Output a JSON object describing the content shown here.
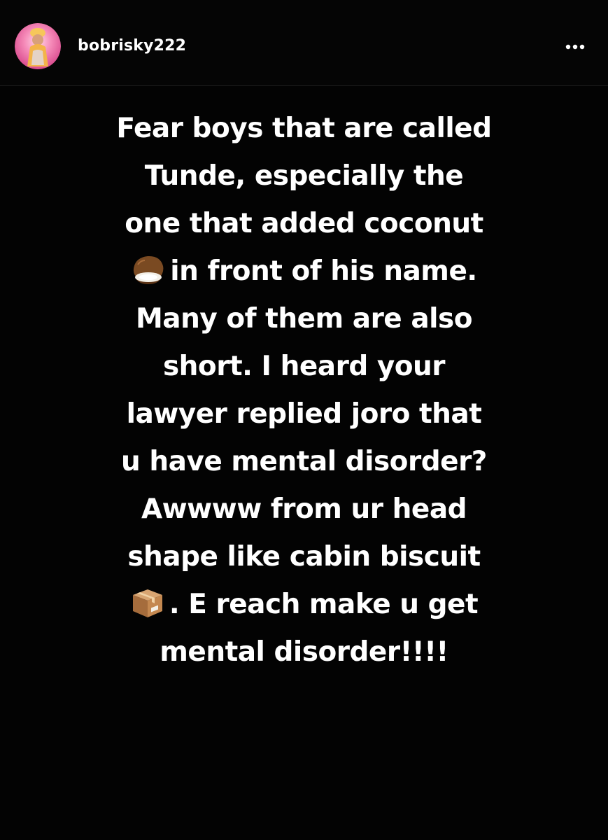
{
  "header": {
    "username": "bobrisky222",
    "avatar_icon": "profile-avatar",
    "more_icon": "more-horizontal-icon"
  },
  "story": {
    "background": "#000000",
    "text_color": "#ffffff",
    "lines": [
      "Fear boys that are called",
      "Tunde, especially the",
      "one that added coconut",
      "in front of his name.",
      "Many of them are also",
      "short. I heard your",
      "lawyer replied joro that",
      "u have mental disorder?",
      "Awwww from ur head",
      "shape like cabin biscuit",
      ". E reach make u get",
      "mental disorder!!!!"
    ],
    "emojis": {
      "line4": "coconut-emoji",
      "line11": "package-emoji"
    }
  }
}
